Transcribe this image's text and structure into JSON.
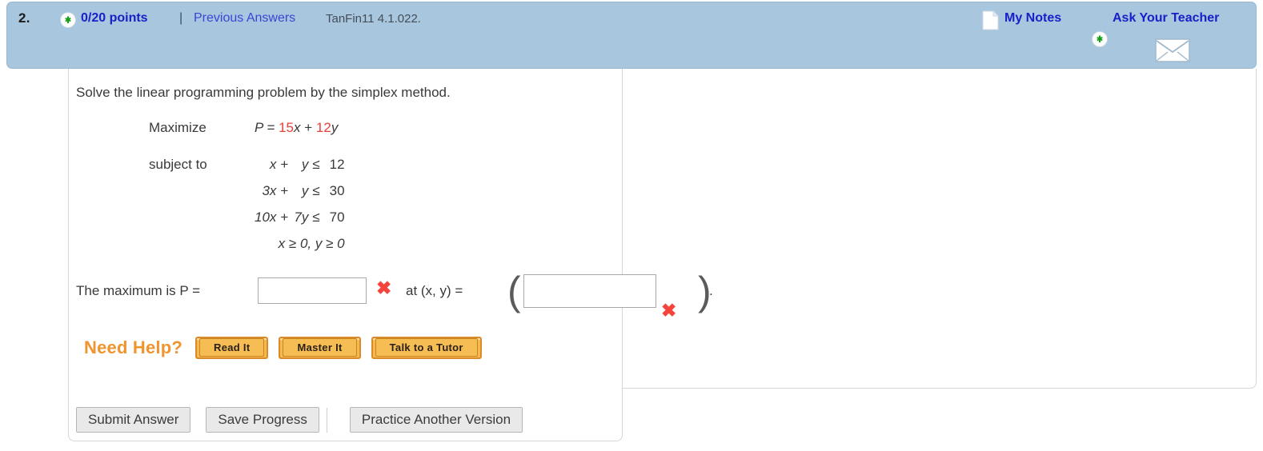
{
  "header": {
    "question_number": "2.",
    "plus_icon": "plus-circle-icon",
    "points": "0/20 points",
    "separator": "|",
    "previous_answers": "Previous Answers",
    "assignment_code": "TanFin11 4.1.022.",
    "notes_icon": "page-icon",
    "my_notes": "My Notes",
    "plus_icon_2": "plus-circle-icon",
    "ask_your_teacher": "Ask Your Teacher",
    "envelope_icon": "envelope-icon",
    "background_color": "#a8c6de",
    "link_color": "#1820c8"
  },
  "problem": {
    "prompt": "Solve the linear programming problem by the simplex method.",
    "objective": {
      "label": "Maximize",
      "prefix": "P = ",
      "coef1": "15",
      "var1": "x",
      "plus": " + ",
      "coef2": "12",
      "var2": "y",
      "coefficient_color": "#e8403a"
    },
    "subject_label": "subject to",
    "constraints": [
      {
        "lhs": "x",
        "op": "+",
        "rhs": "y",
        "rel": "≤",
        "value": "12"
      },
      {
        "lhs": "3x",
        "op": "+",
        "rhs": "y",
        "rel": "≤",
        "value": "30"
      },
      {
        "lhs": "10x",
        "op": "+",
        "rhs": "7y",
        "rel": "≤",
        "value": "70"
      }
    ],
    "nonnegativity": "x ≥ 0, y ≥ 0"
  },
  "answer": {
    "label": "The maximum is P =",
    "input_1_value": "",
    "input_1_placeholder": "",
    "mark_1": "✖",
    "at_label": "at  (x, y) =",
    "paren_open": "(",
    "input_2_value": "",
    "input_2_placeholder": "",
    "mark_2": "✖",
    "paren_close": ")",
    "period": ".",
    "mark_color": "#f4443c"
  },
  "need_help": {
    "label": "Need Help?",
    "label_color": "#f0942e",
    "buttons": [
      {
        "label": "Read It"
      },
      {
        "label": "Master It"
      },
      {
        "label": "Talk to a Tutor"
      }
    ]
  },
  "bottom_actions": {
    "submit": "Submit Answer",
    "save": "Save Progress",
    "practice": "Practice Another Version"
  }
}
